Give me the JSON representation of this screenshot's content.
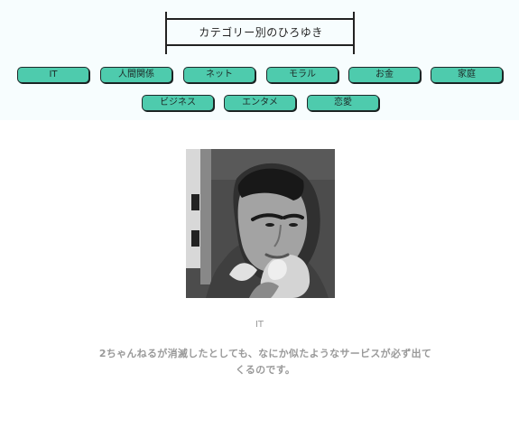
{
  "header": {
    "title": "カテゴリー別のひろゆき"
  },
  "categories": [
    {
      "label": "IT"
    },
    {
      "label": "人間関係"
    },
    {
      "label": "ネット"
    },
    {
      "label": "モラル"
    },
    {
      "label": "お金"
    },
    {
      "label": "家庭"
    },
    {
      "label": "ビジネス"
    },
    {
      "label": "エンタメ"
    },
    {
      "label": "恋愛"
    }
  ],
  "content": {
    "category": "IT",
    "quote": "2ちゃんねるが消滅したとしても、なにか似たようなサービスが必ず出てくるのです。"
  }
}
